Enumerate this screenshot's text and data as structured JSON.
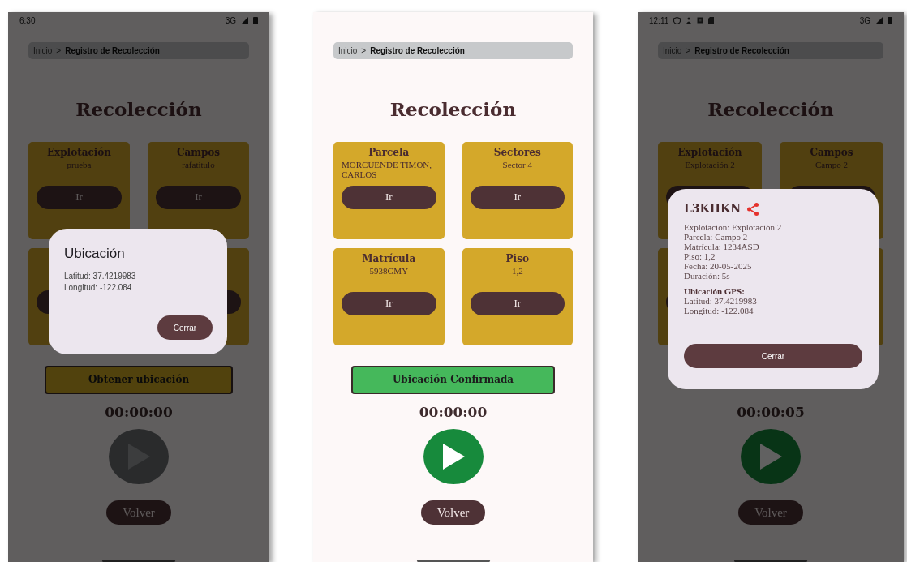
{
  "phones": [
    {
      "status_bar": {
        "time": "6:30",
        "network": "3G",
        "notification_icons": false
      },
      "dimmed": true,
      "breadcrumb": {
        "home": "Inicio",
        "separator": ">",
        "current": "Registro de Recolección"
      },
      "title": "Recolección",
      "cards": [
        {
          "kind": "field",
          "title": "Explotación",
          "value": "prueba",
          "button": "Ir"
        },
        {
          "kind": "field",
          "title": "Campos",
          "value": "rafatitulo",
          "button": "Ir"
        },
        {
          "kind": "blank"
        },
        {
          "kind": "blank"
        }
      ],
      "location_button": {
        "label": "Obtener ubicación",
        "confirmed": false
      },
      "timer": "00:00:00",
      "play_button": {
        "active": false
      },
      "back_button": "Volver",
      "dialog": {
        "kind": "location",
        "title": "Ubicación",
        "lines": [
          {
            "text": "Latitud: 37.4219983",
            "bold": false
          },
          {
            "text": "Longitud: -122.084",
            "bold": false
          }
        ],
        "button": "Cerrar"
      }
    },
    {
      "dimmed": false,
      "breadcrumb": {
        "home": "Inicio",
        "separator": ">",
        "current": "Registro de Recolección"
      },
      "title": "Recolección",
      "cards": [
        {
          "kind": "field",
          "title": "Parcela",
          "value": "MORCUENDE TIMON, CARLOS",
          "button": "Ir"
        },
        {
          "kind": "field",
          "title": "Sectores",
          "value": "Sector 4",
          "button": "Ir"
        },
        {
          "kind": "field",
          "title": "Matrícula",
          "value": "5938GMY",
          "button": "Ir"
        },
        {
          "kind": "field",
          "title": "Piso",
          "value": "1,2",
          "button": "Ir"
        }
      ],
      "location_button": {
        "label": "Ubicación Confirmada",
        "confirmed": true
      },
      "timer": "00:00:00",
      "play_button": {
        "active": true
      },
      "back_button": "Volver"
    },
    {
      "status_bar": {
        "time": "12:11",
        "network": "3G",
        "notification_icons": true
      },
      "dimmed": true,
      "breadcrumb": {
        "home": "Inicio",
        "separator": ">",
        "current": "Registro de Recolección"
      },
      "title": "Recolección",
      "cards": [
        {
          "kind": "field",
          "title": "Explotación",
          "value": "Explotación 2"
        },
        {
          "kind": "field",
          "title": "Campos",
          "value": "Campo 2"
        },
        {
          "kind": "blank"
        },
        {
          "kind": "blank"
        }
      ],
      "timer": "00:00:05",
      "play_button": {
        "active": true
      },
      "back_button": "Volver",
      "dialog": {
        "kind": "record",
        "title": "L3KHKN",
        "share": true,
        "lines": [
          {
            "text": "Explotación: Explotación 2",
            "bold": false
          },
          {
            "text": "Parcela: Campo 2",
            "bold": false
          },
          {
            "text": "Matrícula: 1234ASD",
            "bold": false
          },
          {
            "text": "Piso: 1,2",
            "bold": false
          },
          {
            "text": "Fecha: 20-05-2025",
            "bold": false
          },
          {
            "text": "Duración: 5s",
            "bold": false
          },
          {
            "text": "Ubicación GPS:",
            "bold": true
          },
          {
            "text": "Latitud: 37.4219983",
            "bold": false
          },
          {
            "text": "Longitud: -122.084",
            "bold": false
          }
        ],
        "button": "Cerrar"
      }
    }
  ]
}
